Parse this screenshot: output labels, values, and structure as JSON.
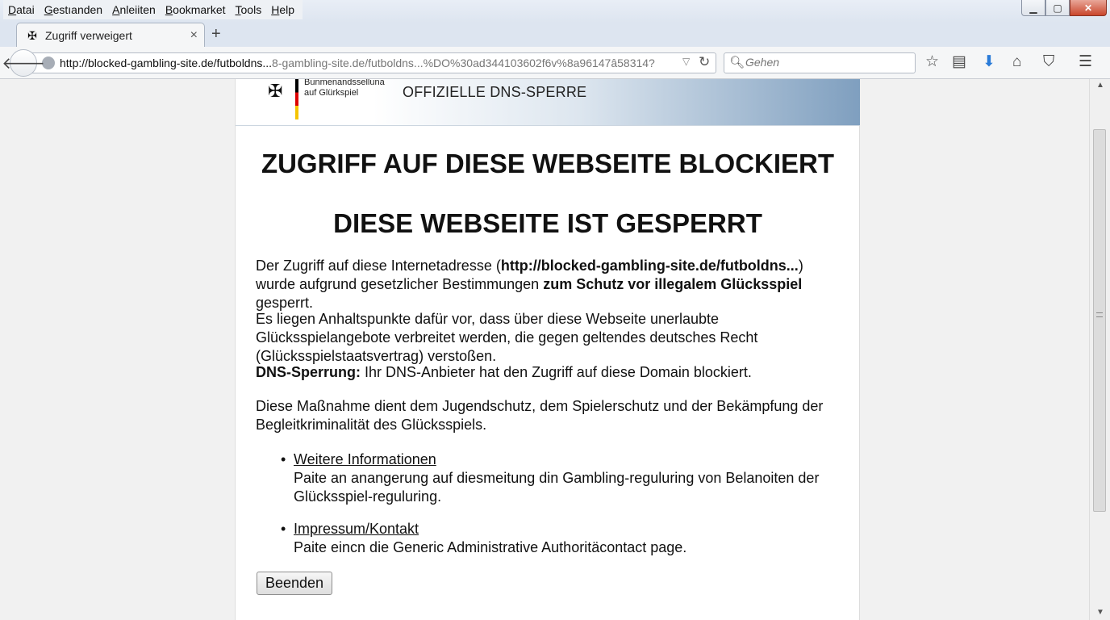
{
  "menu": [
    "Datai",
    "Gestıanden",
    "Anleiiten",
    "Bookmarket",
    "Tools",
    "Help"
  ],
  "window_buttons": {
    "minimize": "▁",
    "maximize": "▢",
    "close": "✕"
  },
  "tab": {
    "title": "Zugriff verweigert",
    "favicon": "eagle-icon",
    "close": "×",
    "new_tab": "+"
  },
  "nav": {
    "url_main": "http://blocked-gambling-site.de/futboldns...",
    "url_rest": "8-gambling-site.de/futboldns...%DO%30ad344103602f6v%8a96147â58314?",
    "search_placeholder": "Gehen"
  },
  "page": {
    "authority_line1": "Bunmenandsselluna",
    "authority_line2": "auf Glürkspiel",
    "banner_title": "OFFIZIELLE DNS-SPERRE",
    "heading1": "ZUGRIFF AUF DIESE WEBSEITE BLOCKIERT",
    "heading2": "DIESE WEBSEITE IST GESPERRT",
    "p1_a": "Der Zugriff auf diese Internetadresse (",
    "p1_url": "http://blocked-gambling-site.de/futboldns...",
    "p1_b": ") wurde aufgrund gesetzlicher Bestimmungen ",
    "p1_bold": "zum Schutz vor illegalem Glücksspiel",
    "p1_c": " gesperrt.",
    "p2": "Es liegen Anhaltspunkte dafür vor, dass über diese Webseite unerlaubte Glücksspielangebote verbreitet werden, die gegen geltendes deutsches Recht (Glücksspielstaatsvertrag) verstoßen.",
    "p3_bold": "DNS-Sperrung:",
    "p3_rest": " Ihr DNS-Anbieter hat den Zugriff auf diese Domain blockiert.",
    "p4": "Diese Maßnahme dient dem Jugendschutz, dem Spielerschutz und der Bekämpfung der Begleitkriminalität des Glücksspiels.",
    "links": [
      {
        "label": "Weitere Informationen",
        "desc": "Paite an anangerung auf diesmeitung din Gambling-reguluring von Belanoiten der Glücksspiel-reguluring."
      },
      {
        "label": "Impressum/Kontakt",
        "desc": "Paite eincn die Generic Administrative Authoritäcontact page."
      }
    ],
    "button": "Beenden"
  }
}
